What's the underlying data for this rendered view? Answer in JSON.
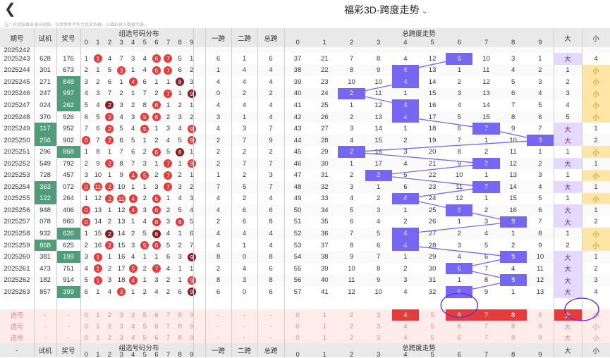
{
  "header": {
    "title": "福彩3D-跨度走势",
    "notice": "注：开奖结果来源于网络，仅供参考不作为兑奖依据，以福彩官方数据为准。"
  },
  "columns": {
    "period": "期号",
    "trial": "试机",
    "prize": "奖号",
    "digit_dist": "组选号码分布",
    "span1": "一跨",
    "span2": "二跨",
    "span_total": "总跨",
    "span_trend": "总跨度走势",
    "big": "大",
    "small": "小"
  },
  "digits": [
    "0",
    "1",
    "2",
    "3",
    "4",
    "5",
    "6",
    "7",
    "8",
    "9"
  ],
  "rows": [
    {
      "p": "2025242",
      "t": "",
      "pr": "",
      "d": [
        null,
        null,
        null,
        null,
        null,
        null,
        null,
        null,
        null,
        null
      ],
      "s1": "",
      "s2": "",
      "st": "",
      "m": [
        "",
        "",
        "",
        "",
        "",
        "",
        "",
        "",
        "",
        ""
      ],
      "sp": -1,
      "bs": "",
      "bsn": ""
    },
    {
      "p": "2025243",
      "t": "628",
      "pr": "176",
      "d": [
        "1",
        {
          "r": "1"
        },
        "4",
        "7",
        "3",
        "4",
        {
          "r": "6"
        },
        {
          "r": "7"
        },
        "5",
        "1"
      ],
      "s1": "6",
      "s2": "1",
      "st": "6",
      "m": [
        "37",
        "21",
        "7",
        "8",
        "4",
        "12",
        "6",
        "10",
        "3",
        "1"
      ],
      "sp": 6,
      "bs": "big",
      "bsn": "4"
    },
    {
      "p": "2025244",
      "t": "301",
      "pr": "673",
      "d": [
        "2",
        "1",
        "5",
        {
          "r": "3"
        },
        "1",
        "4",
        {
          "r": "6"
        },
        {
          "r": "7"
        },
        "6",
        "2"
      ],
      "s1": "1",
      "s2": "4",
      "st": "4",
      "m": [
        "38",
        "22",
        "8",
        "9",
        "4",
        "13",
        "1",
        "11",
        "4",
        "2"
      ],
      "sp": 4,
      "bs": "small",
      "bsn": "1"
    },
    {
      "p": "2025245",
      "t": "271",
      "pr": "848",
      "d": [
        "3",
        "2",
        "6",
        "1",
        {
          "r": "4"
        },
        "6",
        "1",
        "1",
        {
          "d": "8"
        },
        "3"
      ],
      "s1": "4",
      "s2": "4",
      "st": "4",
      "m": [
        "39",
        "23",
        "10",
        "10",
        "4",
        "14",
        "2",
        "12",
        "5",
        "3"
      ],
      "sp": 4,
      "bs": "small",
      "bsn": "2"
    },
    {
      "p": "2025246",
      "t": "247",
      "pr": "997",
      "d": [
        "4",
        "3",
        "7",
        "2",
        "1",
        "7",
        "2",
        {
          "r": "7"
        },
        "1",
        {
          "d": "9"
        }
      ],
      "s1": "0",
      "s2": "2",
      "st": "2",
      "m": [
        "40",
        "24",
        "2",
        "11",
        "1",
        "15",
        "3",
        "13",
        "6",
        "4"
      ],
      "sp": 2,
      "bs": "small",
      "bsn": "3"
    },
    {
      "p": "2025247",
      "t": "024",
      "pr": "262",
      "d": [
        "5",
        "4",
        {
          "d": "2"
        },
        "3",
        "2",
        "8",
        {
          "r": "6"
        },
        "1",
        "2",
        "1"
      ],
      "s1": "4",
      "s2": "4",
      "st": "4",
      "m": [
        "41",
        "25",
        "1",
        "12",
        "4",
        "16",
        "4",
        "14",
        "7",
        "5"
      ],
      "sp": 4,
      "bs": "small",
      "bsn": "4"
    },
    {
      "p": "2025248",
      "t": "370",
      "pr": "526",
      "d": [
        "6",
        "5",
        {
          "r": "2"
        },
        "4",
        "3",
        {
          "r": "5"
        },
        {
          "r": "6"
        },
        "2",
        "3",
        "2"
      ],
      "s1": "3",
      "s2": "1",
      "st": "4",
      "m": [
        "42",
        "26",
        "2",
        "13",
        "4",
        "17",
        "5",
        "15",
        "8",
        "6"
      ],
      "sp": 4,
      "bs": "small",
      "bsn": "5"
    },
    {
      "p": "2025249",
      "t": "117",
      "pr": "952",
      "d": [
        "7",
        "6",
        {
          "r": "2"
        },
        "5",
        "4",
        {
          "r": "5"
        },
        "1",
        "3",
        "4",
        {
          "r": "9"
        }
      ],
      "s1": "4",
      "s2": "3",
      "st": "7",
      "m": [
        "43",
        "27",
        "3",
        "14",
        "1",
        "18",
        "6",
        "7",
        "9",
        "7"
      ],
      "sp": 7,
      "bs": "big",
      "bsn": "1"
    },
    {
      "p": "2025250",
      "t": "256",
      "pr": "902",
      "d": [
        {
          "r": "0"
        },
        "7",
        {
          "r": "2"
        },
        "6",
        "5",
        "1",
        "2",
        "4",
        "5",
        {
          "r": "9"
        }
      ],
      "s1": "2",
      "s2": "7",
      "st": "9",
      "m": [
        "44",
        "28",
        "4",
        "15",
        "2",
        "19",
        "7",
        "1",
        "10",
        "9"
      ],
      "sp": 9,
      "bs": "big",
      "bsn": "2"
    },
    {
      "p": "2025251",
      "t": "296",
      "pr": "868",
      "d": [
        "1",
        "8",
        "1",
        "7",
        "6",
        "2",
        {
          "r": "6"
        },
        "5",
        {
          "d": "8"
        },
        "1"
      ],
      "s1": "2",
      "s2": "2",
      "st": "2",
      "m": [
        "45",
        "29",
        "2",
        "16",
        "3",
        "20",
        "8",
        "2",
        "11",
        "1"
      ],
      "sp": 2,
      "bs": "small",
      "bsn": "1"
    },
    {
      "p": "2025252",
      "t": "549",
      "pr": "792",
      "d": [
        "2",
        "9",
        {
          "r": "2"
        },
        "8",
        "7",
        "3",
        "1",
        {
          "r": "7"
        },
        "1",
        {
          "r": "9"
        }
      ],
      "s1": "2",
      "s2": "7",
      "st": "7",
      "m": [
        "46",
        "30",
        "1",
        "17",
        "4",
        "21",
        "9",
        "7",
        "12",
        "2"
      ],
      "sp": 7,
      "bs": "big",
      "bsn": "1"
    },
    {
      "p": "2025253",
      "t": "728",
      "pr": "457",
      "d": [
        "3",
        "10",
        "1",
        "9",
        {
          "r": "4"
        },
        {
          "r": "5"
        },
        "2",
        {
          "r": "7"
        },
        "2",
        "1"
      ],
      "s1": "1",
      "s2": "2",
      "st": "3",
      "m": [
        "47",
        "31",
        "2",
        "3",
        "5",
        "22",
        "10",
        "1",
        "13",
        "3"
      ],
      "sp": 3,
      "bs": "small",
      "bsn": "1"
    },
    {
      "p": "2025254",
      "t": "363",
      "pr": "072",
      "d": [
        {
          "r": "0"
        },
        {
          "r": "11"
        },
        {
          "r": "2"
        },
        "10",
        "1",
        "1",
        "3",
        {
          "r": "7"
        },
        "3",
        "2"
      ],
      "s1": "7",
      "s2": "5",
      "st": "7",
      "m": [
        "48",
        "32",
        "3",
        "1",
        "6",
        "23",
        "11",
        "7",
        "14",
        "4"
      ],
      "sp": 7,
      "bs": "big",
      "bsn": "1"
    },
    {
      "p": "2025255",
      "t": "122",
      "pr": "264",
      "d": [
        "1",
        "12",
        {
          "r": "2"
        },
        {
          "r": "11"
        },
        {
          "r": "4"
        },
        "2",
        {
          "r": "6"
        },
        "1",
        "4",
        "3"
      ],
      "s1": "4",
      "s2": "2",
      "st": "4",
      "m": [
        "49",
        "33",
        "4",
        "2",
        "4",
        "24",
        "12",
        "1",
        "15",
        "5"
      ],
      "sp": 4,
      "bs": "small",
      "bsn": "1"
    },
    {
      "p": "2025256",
      "t": "948",
      "pr": "406",
      "d": [
        {
          "r": "0"
        },
        "13",
        "1",
        "12",
        {
          "r": "4"
        },
        "3",
        {
          "r": "6"
        },
        "2",
        "5",
        "4"
      ],
      "s1": "4",
      "s2": "6",
      "st": "6",
      "m": [
        "50",
        "34",
        "5",
        "3",
        "1",
        "25",
        "6",
        "2",
        "16",
        "6"
      ],
      "sp": 6,
      "bs": "big",
      "bsn": "1"
    },
    {
      "p": "2025257",
      "t": "078",
      "pr": "860",
      "d": [
        {
          "r": "0"
        },
        "14",
        "2",
        "13",
        "1",
        "4",
        {
          "r": "6"
        },
        "3",
        {
          "r": "8"
        },
        "5"
      ],
      "s1": "2",
      "s2": "6",
      "st": "8",
      "m": [
        "51",
        "35",
        "6",
        "4",
        "2",
        "26",
        "1",
        "3",
        "8",
        "7"
      ],
      "sp": 8,
      "bs": "big",
      "bsn": "2"
    },
    {
      "p": "2025258",
      "t": "932",
      "pr": "626",
      "d": [
        "1",
        "15",
        {
          "d": "2"
        },
        "14",
        "2",
        "5",
        {
          "d": "6"
        },
        "4",
        "1",
        "6"
      ],
      "s1": "4",
      "s2": "4",
      "st": "4",
      "m": [
        "52",
        "36",
        "7",
        "5",
        "4",
        "27",
        "2",
        "4",
        "1",
        "8"
      ],
      "sp": 4,
      "bs": "small",
      "bsn": "1"
    },
    {
      "p": "2025259",
      "t": "868",
      "pr": "625",
      "d": [
        "2",
        "16",
        {
          "r": "2"
        },
        "15",
        "3",
        {
          "r": "5"
        },
        {
          "r": "6"
        },
        "5",
        "2",
        "7"
      ],
      "s1": "4",
      "s2": "1",
      "st": "4",
      "m": [
        "53",
        "37",
        "8",
        "6",
        "4",
        "28",
        "3",
        "5",
        "2",
        "9"
      ],
      "sp": 4,
      "bs": "small",
      "bsn": "2"
    },
    {
      "p": "2025260",
      "t": "381",
      "pr": "199",
      "d": [
        "3",
        {
          "r": "1"
        },
        "1",
        "16",
        "4",
        "1",
        "1",
        "6",
        "3",
        {
          "d": "9"
        }
      ],
      "s1": "8",
      "s2": "0",
      "st": "8",
      "m": [
        "54",
        "38",
        "9",
        "7",
        "1",
        "29",
        "4",
        "6",
        "8",
        "10"
      ],
      "sp": 8,
      "bs": "big",
      "bsn": "1"
    },
    {
      "p": "2025261",
      "t": "473",
      "pr": "751",
      "d": [
        "4",
        {
          "r": "1"
        },
        "2",
        "17",
        {
          "r": "5"
        },
        "2",
        {
          "r": "7"
        },
        "4",
        "1",
        "1"
      ],
      "s1": "2",
      "s2": "4",
      "st": "6",
      "m": [
        "55",
        "39",
        "10",
        "8",
        "2",
        "30",
        "6",
        "7",
        "4",
        "11"
      ],
      "sp": 6,
      "bs": "big",
      "bsn": "2"
    },
    {
      "p": "2025262",
      "t": "182",
      "pr": "914",
      "d": [
        "5",
        {
          "r": "1"
        },
        "3",
        "18",
        {
          "r": "4"
        },
        "1",
        "3",
        "2",
        "1",
        {
          "r": "9"
        }
      ],
      "s1": "8",
      "s2": "3",
      "st": "8",
      "m": [
        "56",
        "40",
        "11",
        "9",
        "3",
        "31",
        "1",
        "8",
        "8",
        "12"
      ],
      "sp": 8,
      "bs": "big",
      "bsn": "3"
    },
    {
      "p": "2025263",
      "t": "857",
      "pr": "399",
      "d": [
        "6",
        "1",
        "4",
        {
          "r": "3"
        },
        "1",
        "2",
        "4",
        "2",
        "6",
        {
          "d": "9"
        }
      ],
      "s1": "6",
      "s2": "0",
      "st": "6",
      "m": [
        "57",
        "41",
        "12",
        "10",
        "4",
        "32",
        "6",
        "9",
        "1",
        "13"
      ],
      "sp": 6,
      "bs": "big",
      "bsn": "4"
    }
  ],
  "select_rows": [
    {
      "label": "选号",
      "dash": "-",
      "digits": [
        "0",
        "1",
        "2",
        "3",
        "4",
        "5",
        "6",
        "7",
        "8",
        "9"
      ],
      "spans": [
        "0",
        "1",
        "2",
        "3",
        "4",
        "5",
        "6",
        "7",
        "8",
        "9"
      ],
      "big": "大",
      "small": "小",
      "active": [
        4,
        6,
        7,
        8
      ],
      "bigActive": true
    },
    {
      "label": "选号",
      "dash": "-",
      "digits": [
        "0",
        "1",
        "2",
        "3",
        "4",
        "5",
        "6",
        "7",
        "8",
        "9"
      ],
      "spans": [
        "0",
        "1",
        "2",
        "3",
        "4",
        "5",
        "6",
        "7",
        "8",
        "9"
      ],
      "big": "大",
      "small": "小",
      "active": [],
      "bigActive": false
    },
    {
      "label": "选号",
      "dash": "-",
      "digits": [
        "0",
        "1",
        "2",
        "3",
        "4",
        "5",
        "6",
        "7",
        "8",
        "9"
      ],
      "spans": [
        "0",
        "1",
        "2",
        "3",
        "4",
        "5",
        "6",
        "7",
        "8",
        "9"
      ],
      "big": "大",
      "small": "小",
      "active": [],
      "bigActive": false
    }
  ],
  "footer": {
    "dash": "-"
  },
  "colors": {
    "accent": "#7667f2",
    "red": "#e43b3b",
    "green": "#4f9d7a"
  }
}
